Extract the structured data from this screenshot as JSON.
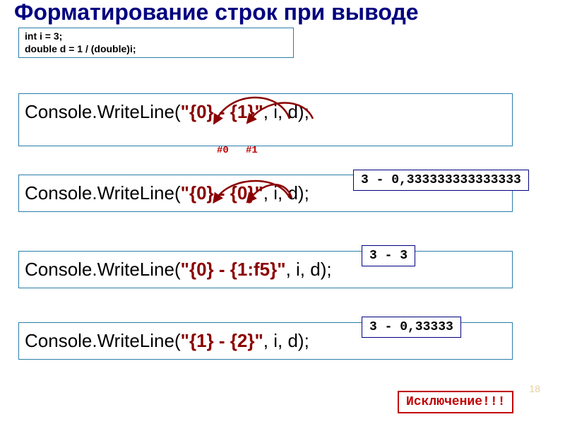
{
  "title": "Форматирование строк при выводе",
  "decl": {
    "line1": "int i = 3;",
    "line2": "double d = 1 / (double)i;"
  },
  "ex1": {
    "prefix": "Console.WriteLine(",
    "fmt": "\"{0} - {1}\"",
    "suffix": ", i, d);",
    "label0": "#0",
    "label1": "#1",
    "output": "3 - 0,333333333333333"
  },
  "ex2": {
    "prefix": "Console.WriteLine(",
    "fmt": "\"{0} - {0}\"",
    "suffix": ", i, d);",
    "output": "3 - 3"
  },
  "ex3": {
    "prefix": "Console.WriteLine(",
    "fmt": "\"{0} - {1:f5}\"",
    "suffix": ", i, d);",
    "output": "3 - 0,33333"
  },
  "ex4": {
    "prefix": "Console.WriteLine(",
    "fmt": "\"{1} - {2}\"",
    "suffix": ", i, d);",
    "exception": "Исключение!!!"
  },
  "pagenum": "18"
}
